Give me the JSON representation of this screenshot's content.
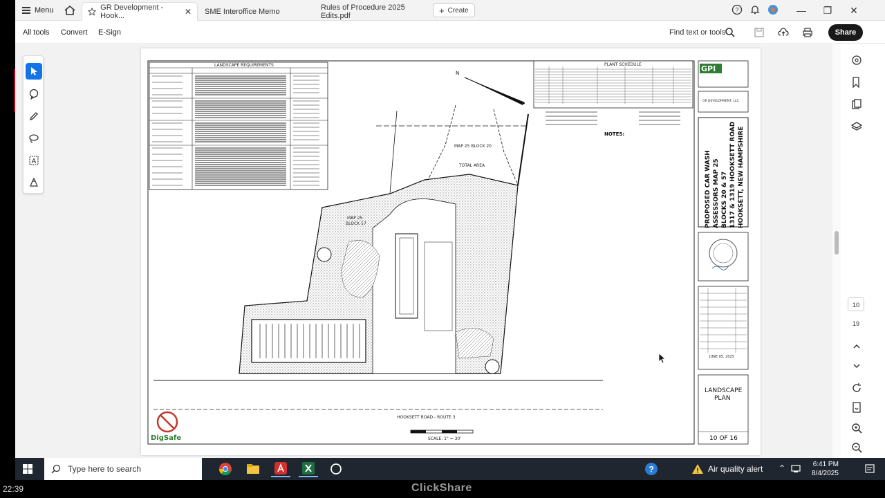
{
  "tabbar": {
    "menu_label": "Menu",
    "tabs": [
      {
        "label": "GR Development - Hook..."
      },
      {
        "label": "SME Interoffice Memo"
      },
      {
        "label": "Rules of Procedure 2025 Edits.pdf"
      }
    ],
    "create_label": "Create"
  },
  "toolbar": {
    "all_tools": "All tools",
    "convert": "Convert",
    "esign": "E-Sign",
    "find_label": "Find text or tools",
    "share_label": "Share"
  },
  "rightrail": {
    "current_page": "10",
    "total_pages": "19"
  },
  "plan": {
    "landscape_requirements": "LANDSCAPE REQUIREMENTS",
    "plant_schedule": "PLANT SCHEDULE",
    "notes": "NOTES:",
    "map_block_20": "MAP 25 BLOCK 20",
    "total_area": "TOTAL AREA",
    "map_25": "MAP 25",
    "block_57": "BLOCK 57",
    "road": "HOOKSETT ROAD - ROUTE 3",
    "scale": "SCALE: 1\" = 30'",
    "gpi": "GPI",
    "prepared_for": "GR DEVELOPMENT, LLC",
    "project_title_1": "PROPOSED CAR WASH",
    "project_title_2": "ASSESSORS MAP 25",
    "project_title_3": "BLOCKS 20 & 57",
    "project_title_4": "1317 & 1319 HOOKSETT ROAD",
    "project_title_5": "HOOKSETT, NEW HAMPSHIRE",
    "date": "JUNE 05, 2025",
    "sheet_title_1": "LANDSCAPE",
    "sheet_title_2": "PLAN",
    "sheet_number": "10 OF 16",
    "digsafe": "DigSafe",
    "north": "N"
  },
  "taskbar": {
    "search_placeholder": "Type here to search",
    "air_quality": "Air quality alert",
    "time": "6:41 PM",
    "date": "8/4/2025"
  },
  "bottombar": {
    "timer": "22:39",
    "clickshare": "ClickShare"
  }
}
